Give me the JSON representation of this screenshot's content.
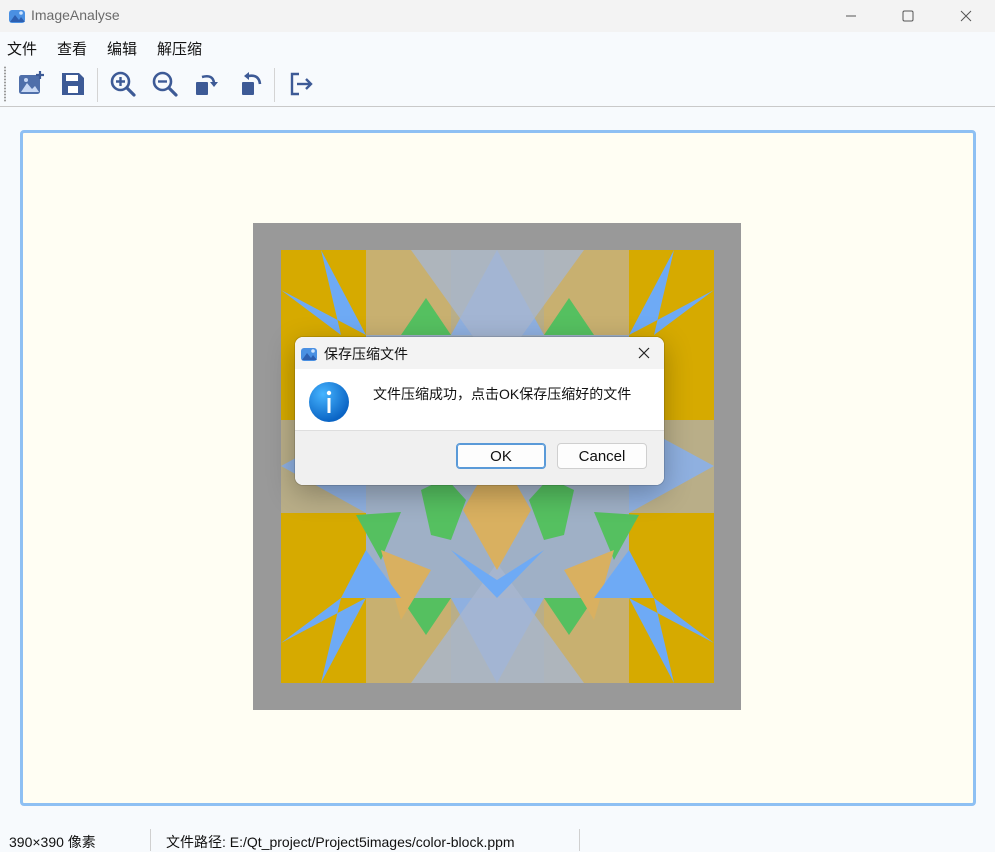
{
  "window": {
    "title": "ImageAnalyse"
  },
  "menu": [
    "文件",
    "查看",
    "编辑",
    "解压缩"
  ],
  "toolbar": {
    "buttons": [
      "open-image-icon",
      "save-icon",
      "zoom-in-icon",
      "zoom-out-icon",
      "rotate-right-icon",
      "rotate-left-icon",
      "exit-icon"
    ]
  },
  "dialog": {
    "title": "保存压缩文件",
    "message": "文件压缩成功，点击OK保存压缩好的文件",
    "ok_label": "OK",
    "cancel_label": "Cancel",
    "icon": "info-icon"
  },
  "status": {
    "size": "390×390 像素",
    "path": "文件路径: E:/Qt_project/Project5images/color-block.ppm"
  },
  "colors": {
    "accent": "#3d5a96",
    "viewer_border": "#8ec0f3",
    "viewer_bg": "#fffef3",
    "frame": "#999999",
    "gold": "#d6aa00",
    "blue": "#6eaaf5",
    "green": "#55c060",
    "tan": "#b9ae88"
  }
}
